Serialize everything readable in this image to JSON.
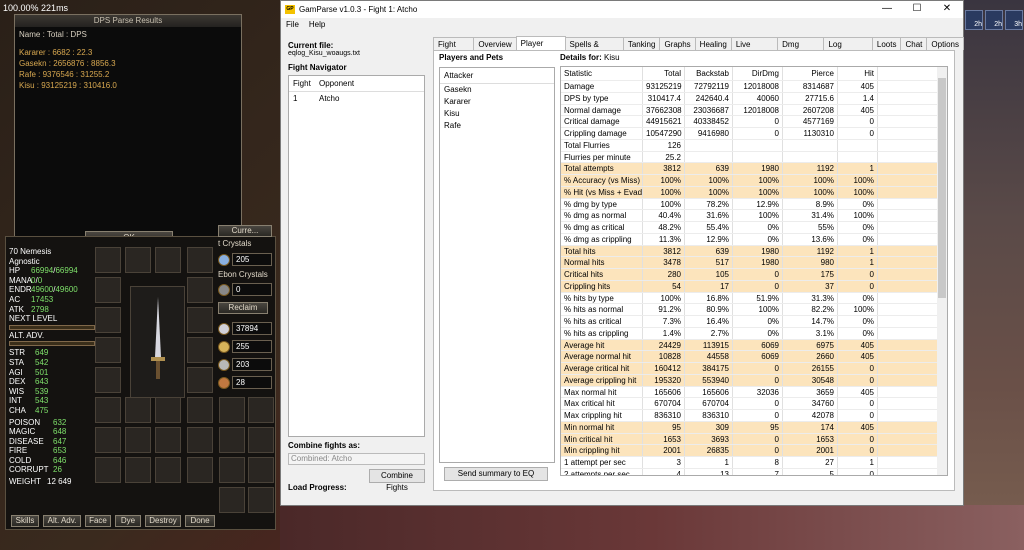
{
  "hud": {
    "fps": "100.00%",
    "latency": "221ms"
  },
  "dps_popup": {
    "title": "DPS Parse Results",
    "header": "Name : Total : DPS",
    "lines": [
      "Kararer : 6682 : 22.3",
      "Gasekn : 2656876 : 8856.3",
      "Rafe : 9376546 : 31255.2",
      "Kisu : 93125219 : 310416.0"
    ],
    "ok_label": "OK"
  },
  "inventory": {
    "level_class": "70 Nemesis",
    "deity": "Agnostic",
    "stats": [
      {
        "k": "HP",
        "v": "66994",
        "max": "66994"
      },
      {
        "k": "MANA",
        "v": "0",
        "max": "0"
      },
      {
        "k": "ENDR",
        "v": "49600",
        "max": "49600"
      },
      {
        "k": "AC",
        "v": "17453",
        "max": ""
      },
      {
        "k": "ATK",
        "v": "2798",
        "max": ""
      }
    ],
    "next_level": "NEXT LEVEL",
    "alt_adv": "ALT. ADV.",
    "attributes": [
      {
        "k": "STR",
        "v": "649"
      },
      {
        "k": "STA",
        "v": "542"
      },
      {
        "k": "AGI",
        "v": "501"
      },
      {
        "k": "DEX",
        "v": "643"
      },
      {
        "k": "WIS",
        "v": "539"
      },
      {
        "k": "INT",
        "v": "543"
      },
      {
        "k": "CHA",
        "v": "475"
      }
    ],
    "resists": [
      {
        "k": "POISON",
        "v": "632"
      },
      {
        "k": "MAGIC",
        "v": "648"
      },
      {
        "k": "DISEASE",
        "v": "647"
      },
      {
        "k": "FIRE",
        "v": "653"
      },
      {
        "k": "COLD",
        "v": "646"
      },
      {
        "k": "CORRUPT",
        "v": "26"
      }
    ],
    "weight_label": "WEIGHT",
    "weight": "12  649",
    "crystals_label": "Ebon Crystals",
    "crystal_count": "205",
    "crystal_count2": "0",
    "reclaim_label": "Reclaim",
    "coins": [
      "37894",
      "255",
      "203",
      "28"
    ],
    "currency_btn": "Curre...",
    "crystals_btn": "t Crystals",
    "buttons": [
      "Skills",
      "Alt. Adv.",
      "Face",
      "Dye",
      "Destroy",
      "Done"
    ]
  },
  "gamparse": {
    "title": "GamParse v1.0.3 - Fight 1: Atcho",
    "logo": "GP",
    "menu": [
      "File",
      "Help"
    ],
    "current_file_label": "Current file:",
    "current_file": "eqlog_Kisu_woaugs.txt",
    "fight_nav_label": "Fight Navigator",
    "fight_cols": [
      "Fight",
      "Opponent"
    ],
    "fights": [
      {
        "fight": "1",
        "opponent": "Atcho"
      }
    ],
    "combine_label": "Combine fights as:",
    "combine_placeholder": "Combined: Atcho",
    "combine_button": "Combine Fights",
    "load_progress": "Load Progress:",
    "tabs": [
      "Fight List",
      "Overview",
      "Player DPS",
      "Spells & Discs",
      "Tanking",
      "Graphs",
      "Healing",
      "Live Fights",
      "Dmg Mods",
      "Log Search",
      "Loots",
      "Chat",
      "Options"
    ],
    "active_tab": "Player DPS",
    "players_label": "Players and Pets",
    "attacker_header": "Attacker",
    "attackers": [
      "Gasekn",
      "Kararer",
      "Kisu",
      "Rafe"
    ],
    "send_button": "Send summary to EQ",
    "details_label": "Details for:",
    "details_for": "Kisu",
    "columns": [
      "Statistic",
      "Total",
      "Backstab",
      "DirDmg",
      "Pierce",
      "Hit"
    ],
    "rows": [
      {
        "hl": false,
        "c": [
          "Damage",
          "93125219",
          "72792119",
          "12018008",
          "8314687",
          "405"
        ]
      },
      {
        "hl": false,
        "c": [
          "DPS by type",
          "310417.4",
          "242640.4",
          "40060",
          "27715.6",
          "1.4"
        ]
      },
      {
        "hl": false,
        "c": [
          "Normal damage",
          "37662308",
          "23036687",
          "12018008",
          "2607208",
          "405"
        ]
      },
      {
        "hl": false,
        "c": [
          "Critical damage",
          "44915621",
          "40338452",
          "0",
          "4577169",
          "0"
        ]
      },
      {
        "hl": false,
        "c": [
          "Crippling damage",
          "10547290",
          "9416980",
          "0",
          "1130310",
          "0"
        ]
      },
      {
        "hl": false,
        "c": [
          "Total Flurries",
          "126",
          "",
          "",
          "",
          ""
        ]
      },
      {
        "hl": false,
        "c": [
          "Flurries per minute",
          "25.2",
          "",
          "",
          "",
          ""
        ]
      },
      {
        "hl": true,
        "c": [
          "Total attempts",
          "3812",
          "639",
          "1980",
          "1192",
          "1"
        ]
      },
      {
        "hl": true,
        "c": [
          "% Accuracy (vs Miss)",
          "100%",
          "100%",
          "100%",
          "100%",
          "100%"
        ]
      },
      {
        "hl": true,
        "c": [
          "% Hit (vs Miss + Evade)",
          "100%",
          "100%",
          "100%",
          "100%",
          "100%"
        ]
      },
      {
        "hl": false,
        "c": [
          "% dmg by type",
          "100%",
          "78.2%",
          "12.9%",
          "8.9%",
          "0%"
        ]
      },
      {
        "hl": false,
        "c": [
          "% dmg as normal",
          "40.4%",
          "31.6%",
          "100%",
          "31.4%",
          "100%"
        ]
      },
      {
        "hl": false,
        "c": [
          "% dmg as critical",
          "48.2%",
          "55.4%",
          "0%",
          "55%",
          "0%"
        ]
      },
      {
        "hl": false,
        "c": [
          "% dmg as crippling",
          "11.3%",
          "12.9%",
          "0%",
          "13.6%",
          "0%"
        ]
      },
      {
        "hl": true,
        "c": [
          "Total hits",
          "3812",
          "639",
          "1980",
          "1192",
          "1"
        ]
      },
      {
        "hl": true,
        "c": [
          "Normal hits",
          "3478",
          "517",
          "1980",
          "980",
          "1"
        ]
      },
      {
        "hl": true,
        "c": [
          "Critical hits",
          "280",
          "105",
          "0",
          "175",
          "0"
        ]
      },
      {
        "hl": true,
        "c": [
          "Crippling hits",
          "54",
          "17",
          "0",
          "37",
          "0"
        ]
      },
      {
        "hl": false,
        "c": [
          "% hits by type",
          "100%",
          "16.8%",
          "51.9%",
          "31.3%",
          "0%"
        ]
      },
      {
        "hl": false,
        "c": [
          "% hits as normal",
          "91.2%",
          "80.9%",
          "100%",
          "82.2%",
          "100%"
        ]
      },
      {
        "hl": false,
        "c": [
          "% hits as critical",
          "7.3%",
          "16.4%",
          "0%",
          "14.7%",
          "0%"
        ]
      },
      {
        "hl": false,
        "c": [
          "% hits as crippling",
          "1.4%",
          "2.7%",
          "0%",
          "3.1%",
          "0%"
        ]
      },
      {
        "hl": true,
        "c": [
          "Average hit",
          "24429",
          "113915",
          "6069",
          "6975",
          "405"
        ]
      },
      {
        "hl": true,
        "c": [
          "Average normal hit",
          "10828",
          "44558",
          "6069",
          "2660",
          "405"
        ]
      },
      {
        "hl": true,
        "c": [
          "Average critical hit",
          "160412",
          "384175",
          "0",
          "26155",
          "0"
        ]
      },
      {
        "hl": true,
        "c": [
          "Average crippling hit",
          "195320",
          "553940",
          "0",
          "30548",
          "0"
        ]
      },
      {
        "hl": false,
        "c": [
          "Max normal hit",
          "165606",
          "165606",
          "32036",
          "3659",
          "405"
        ]
      },
      {
        "hl": false,
        "c": [
          "Max critical hit",
          "670704",
          "670704",
          "0",
          "34760",
          "0"
        ]
      },
      {
        "hl": false,
        "c": [
          "Max crippling hit",
          "836310",
          "836310",
          "0",
          "42078",
          "0"
        ]
      },
      {
        "hl": true,
        "c": [
          "Min normal hit",
          "95",
          "309",
          "95",
          "174",
          "405"
        ]
      },
      {
        "hl": true,
        "c": [
          "Min critical hit",
          "1653",
          "3693",
          "0",
          "1653",
          "0"
        ]
      },
      {
        "hl": true,
        "c": [
          "Min crippling hit",
          "2001",
          "26835",
          "0",
          "2001",
          "0"
        ]
      },
      {
        "hl": false,
        "c": [
          "1 attempt per sec",
          "3",
          "1",
          "8",
          "27",
          "1"
        ]
      },
      {
        "hl": false,
        "c": [
          "2 attempts per sec",
          "4",
          "13",
          "7",
          "5",
          "0"
        ]
      }
    ]
  },
  "buff_icons": [
    "2h",
    "2h",
    "3h"
  ]
}
